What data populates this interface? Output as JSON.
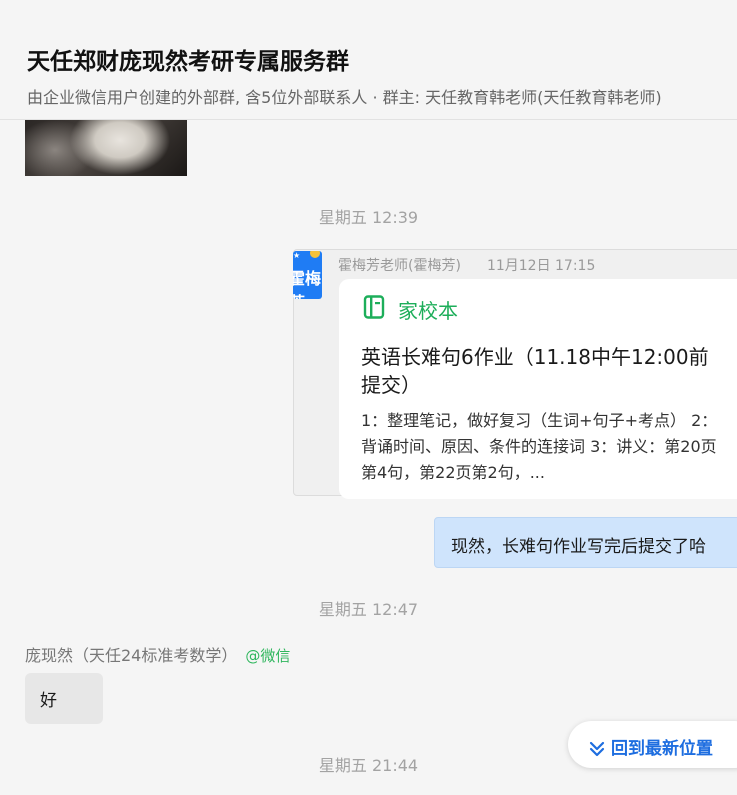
{
  "header": {
    "title": "天任郑财庞现然考研专属服务群",
    "subtitle": "由企业微信用户创建的外部群, 含5位外部联系人 · 群主: 天任教育韩老师(天任教育韩老师)"
  },
  "messages": {
    "time1": "星期五 12:39",
    "forward": {
      "avatar_text": "霍梅芳",
      "sender": "霍梅芳老师(霍梅芳)",
      "time": "11月12日 17:15",
      "card": {
        "app_icon": "notebook-icon",
        "app_name": "家校本",
        "title": "英语长难句6作业（11.18中午12:00前提交）",
        "body": "1：整理笔记，做好复习（生词+句子+考点） 2：背诵时间、原因、条件的连接词 3：讲义：第20页第4句，第22页第2句，..."
      }
    },
    "outgoing": "现然，长难句作业写完后提交了哈",
    "time2": "星期五 12:47",
    "incoming": {
      "sender": "庞现然（天任24标准考数学）",
      "sender_tag": "@微信",
      "text": "好"
    },
    "time3": "星期五 21:44"
  },
  "back_to_latest": {
    "label": "回到最新位置",
    "icon": "double-chevron-down-icon"
  },
  "colors": {
    "accent": "#1e6ee0",
    "green": "#1dae5a",
    "outgoing_bubble": "#cfe4fc"
  }
}
